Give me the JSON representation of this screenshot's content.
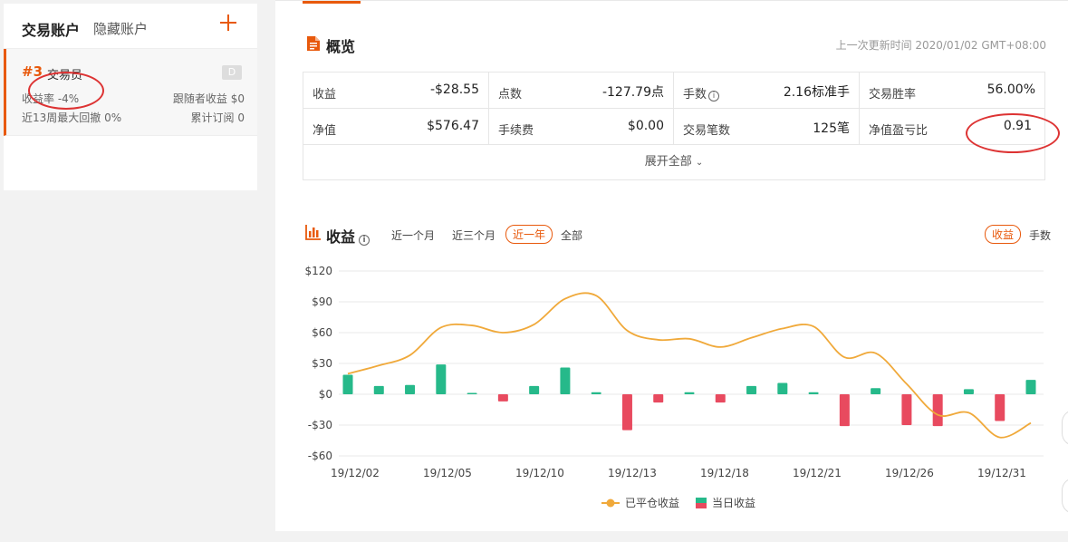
{
  "left_panel": {
    "tabs": [
      "交易账户",
      "隐藏账户"
    ],
    "account": {
      "id": "#3",
      "name": "交易员",
      "badge": "D",
      "return_label": "收益率",
      "return_value": "-4%",
      "follower_label": "跟随者收益",
      "follower_value": "$0",
      "drawdown_label": "近13周最大回撤",
      "drawdown_value": "0%",
      "subs_label": "累计订阅",
      "subs_value": "0"
    }
  },
  "overview": {
    "title": "概览",
    "update_time": "上一次更新时间 2020/01/02 GMT+08:00",
    "rows": [
      [
        {
          "label": "收益",
          "value": "-$28.55"
        },
        {
          "label": "点数",
          "value": "-127.79点"
        },
        {
          "label": "手数",
          "value": "2.16标准手",
          "info": true
        },
        {
          "label": "交易胜率",
          "value": "56.00%"
        }
      ],
      [
        {
          "label": "净值",
          "value": "$576.47"
        },
        {
          "label": "手续费",
          "value": "$0.00"
        },
        {
          "label": "交易笔数",
          "value": "125笔"
        },
        {
          "label": "净值盈亏比",
          "value": "0.91"
        }
      ]
    ],
    "expand_label": "展开全部"
  },
  "profit": {
    "title": "收益",
    "ranges": [
      "近一个月",
      "近三个月",
      "近一年",
      "全部"
    ],
    "active_range": "近一年",
    "metrics": [
      "收益",
      "手数"
    ],
    "active_metric": "收益"
  },
  "colors": {
    "accent": "#e8590c",
    "line": "#f0a93a",
    "positive": "#26b98a",
    "negative": "#e84a5f"
  },
  "chart_data": {
    "type": "bar+line",
    "y_ticks": [
      "$120",
      "$90",
      "$60",
      "$30",
      "$0",
      "-$30",
      "-$60"
    ],
    "ylim": [
      -60,
      120
    ],
    "x_ticks": [
      "19/12/02",
      "19/12/05",
      "19/12/10",
      "19/12/13",
      "19/12/18",
      "19/12/21",
      "19/12/26",
      "19/12/31"
    ],
    "legend": [
      "已平仓收益",
      "当日收益"
    ],
    "series": [
      {
        "name": "已平仓收益",
        "type": "line",
        "values": [
          20,
          28,
          38,
          65,
          67,
          60,
          68,
          93,
          96,
          62,
          53,
          54,
          46,
          55,
          64,
          66,
          36,
          40,
          10,
          -20,
          -18,
          -42,
          -28
        ]
      },
      {
        "name": "当日收益",
        "type": "bar",
        "values": [
          19,
          8,
          9,
          29,
          1,
          -7,
          8,
          26,
          2,
          -35,
          -8,
          2,
          -8,
          8,
          11,
          2,
          -31,
          6,
          -30,
          -31,
          5,
          -26,
          14
        ]
      }
    ]
  }
}
